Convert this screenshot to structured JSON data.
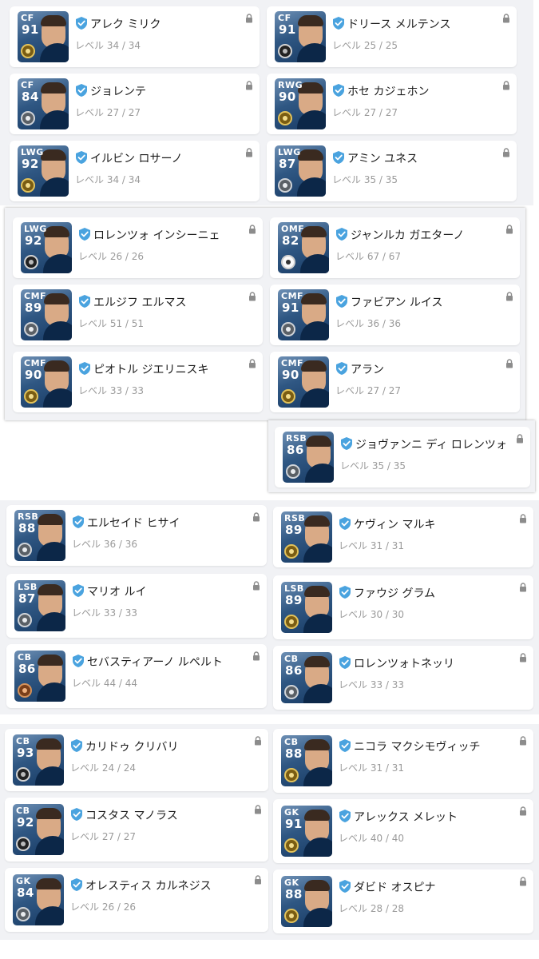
{
  "level_prefix": "レベル",
  "colors": {
    "accent": "#4aa3df",
    "text": "#1b1b1b",
    "muted": "#9a9a9a"
  },
  "icons": {
    "verified": "check-badge-icon",
    "lock": "lock-icon"
  },
  "players": [
    {
      "pos": "CF",
      "ovr": "91",
      "name": "アレク ミリク",
      "level": "レベル 34 / 34",
      "medal": "gold"
    },
    {
      "pos": "CF",
      "ovr": "91",
      "name": "ドリース メルテンス",
      "level": "レベル 25 / 25",
      "medal": "black"
    },
    {
      "pos": "CF",
      "ovr": "84",
      "name": "ジョレンテ",
      "level": "レベル 27 / 27",
      "medal": "silver"
    },
    {
      "pos": "RWG",
      "ovr": "90",
      "name": "ホセ カジェホン",
      "level": "レベル 27 / 27",
      "medal": "gold"
    },
    {
      "pos": "LWG",
      "ovr": "92",
      "name": "イルビン ロサーノ",
      "level": "レベル 34 / 34",
      "medal": "gold"
    },
    {
      "pos": "LWG",
      "ovr": "87",
      "name": "アミン ユネス",
      "level": "レベル 35 / 35",
      "medal": "silver"
    },
    {
      "pos": "LWG",
      "ovr": "92",
      "name": "ロレンツォ インシーニェ",
      "level": "レベル 26 / 26",
      "medal": "black"
    },
    {
      "pos": "OMF",
      "ovr": "82",
      "name": "ジャンルカ ガエターノ",
      "level": "レベル 67 / 67",
      "medal": "white"
    },
    {
      "pos": "CMF",
      "ovr": "89",
      "name": "エルジフ エルマス",
      "level": "レベル 51 / 51",
      "medal": "silver"
    },
    {
      "pos": "CMF",
      "ovr": "91",
      "name": "ファビアン ルイス",
      "level": "レベル 36 / 36",
      "medal": "silver"
    },
    {
      "pos": "CMF",
      "ovr": "90",
      "name": "ピオトル ジエリニスキ",
      "level": "レベル 33 / 33",
      "medal": "gold"
    },
    {
      "pos": "CMF",
      "ovr": "90",
      "name": "アラン",
      "level": "レベル 27 / 27",
      "medal": "gold"
    },
    {
      "pos": "RSB",
      "ovr": "86",
      "name": "ジョヴァンニ ディ ロレンツォ",
      "level": "レベル 35 / 35",
      "medal": "silver"
    },
    {
      "pos": "RSB",
      "ovr": "88",
      "name": "エルセイド ヒサイ",
      "level": "レベル 36 / 36",
      "medal": "silver"
    },
    {
      "pos": "RSB",
      "ovr": "89",
      "name": "ケヴィン マルキ",
      "level": "レベル 31 / 31",
      "medal": "gold"
    },
    {
      "pos": "LSB",
      "ovr": "87",
      "name": "マリオ ルイ",
      "level": "レベル 33 / 33",
      "medal": "silver"
    },
    {
      "pos": "LSB",
      "ovr": "89",
      "name": "ファウジ グラム",
      "level": "レベル 30 / 30",
      "medal": "gold"
    },
    {
      "pos": "CB",
      "ovr": "86",
      "name": "セバスティアーノ ルペルト",
      "level": "レベル 44 / 44",
      "medal": "bronze"
    },
    {
      "pos": "CB",
      "ovr": "86",
      "name": "ロレンツォトネッリ",
      "level": "レベル 33 / 33",
      "medal": "silver"
    },
    {
      "pos": "CB",
      "ovr": "93",
      "name": "カリドゥ クリバリ",
      "level": "レベル 24 / 24",
      "medal": "black"
    },
    {
      "pos": "CB",
      "ovr": "88",
      "name": "ニコラ マクシモヴィッチ",
      "level": "レベル 31 / 31",
      "medal": "gold"
    },
    {
      "pos": "CB",
      "ovr": "92",
      "name": "コスタス マノラス",
      "level": "レベル 27 / 27",
      "medal": "black"
    },
    {
      "pos": "GK",
      "ovr": "91",
      "name": "アレックス メレット",
      "level": "レベル 40 / 40",
      "medal": "gold"
    },
    {
      "pos": "GK",
      "ovr": "84",
      "name": "オレスティス カルネジス",
      "level": "レベル 26 / 26",
      "medal": "silver"
    },
    {
      "pos": "GK",
      "ovr": "88",
      "name": "ダビド オスピナ",
      "level": "レベル 28 / 28",
      "medal": "gold"
    }
  ]
}
